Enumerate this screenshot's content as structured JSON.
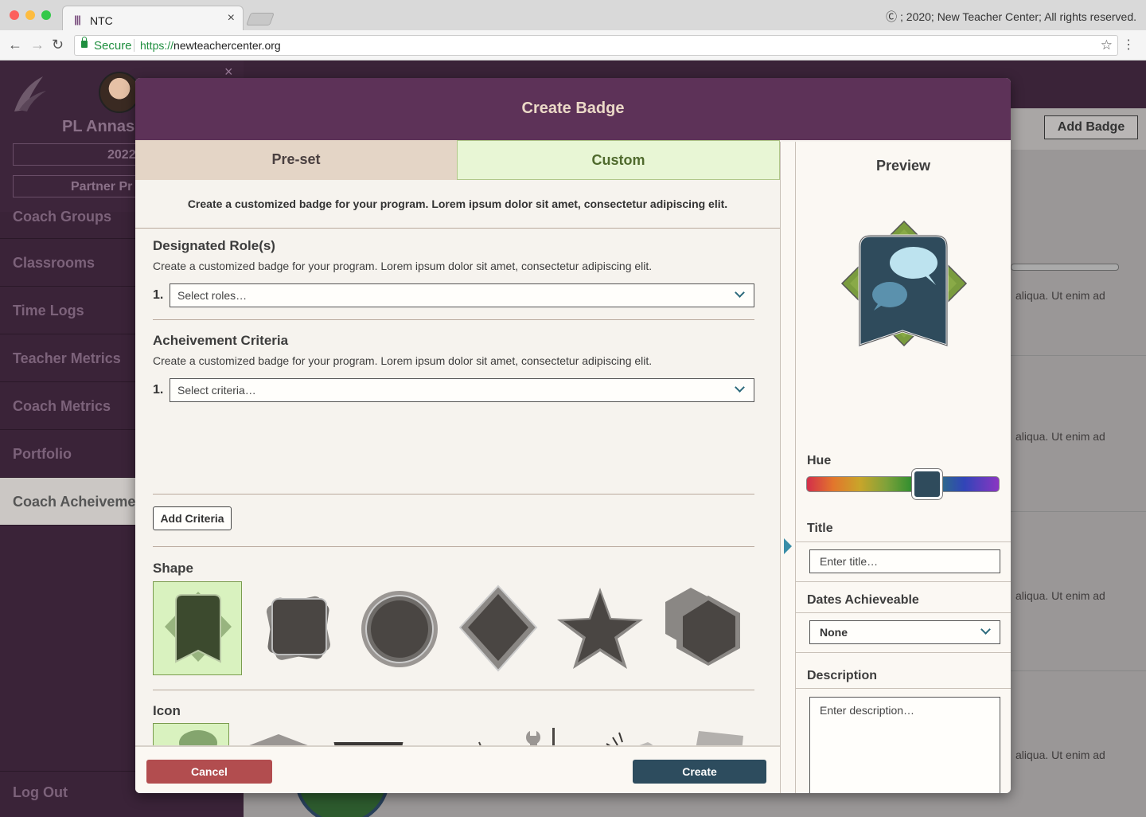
{
  "browser": {
    "tab_title": "NTC",
    "copyright": "Ⓒ ; 2020; New Teacher Center; All rights reserved.",
    "secure_label": "Secure",
    "url_scheme": "https://",
    "url_host": "newteachercenter.org"
  },
  "sidebar": {
    "user_name": "PL Annas",
    "year": "2022",
    "partner": "Partner Pr",
    "items": [
      {
        "label": "Coach Groups"
      },
      {
        "label": "Classrooms"
      },
      {
        "label": "Time Logs"
      },
      {
        "label": "Teacher Metrics"
      },
      {
        "label": "Coach Metrics"
      },
      {
        "label": "Portfolio"
      },
      {
        "label": "Coach Acheivements",
        "active": true
      }
    ],
    "logout": "Log Out"
  },
  "background": {
    "add_badge_label": "Add Badge",
    "row_text": "aliqua. Ut enim ad"
  },
  "modal": {
    "title": "Create Badge",
    "tabs": {
      "preset": "Pre-set",
      "custom": "Custom"
    },
    "intro": "Create a customized badge for your program. Lorem ipsum dolor sit amet, consectetur adipiscing elit.",
    "roles": {
      "title": "Designated Role(s)",
      "desc": "Create a customized badge for your program. Lorem ipsum dolor sit amet, consectetur adipiscing elit.",
      "number": "1.",
      "placeholder": "Select roles…"
    },
    "criteria": {
      "title": "Acheivement Criteria",
      "desc": "Create a customized badge for your program. Lorem ipsum dolor sit amet, consectetur adipiscing elit.",
      "number": "1.",
      "placeholder": "Select criteria…",
      "add_label": "Add Criteria"
    },
    "shape": {
      "title": "Shape",
      "options": [
        "ribbon-badge",
        "square-badge",
        "circle-badge",
        "diamond-badge",
        "star-badge",
        "hexagon-badge"
      ],
      "selected_index": 0
    },
    "icon": {
      "title": "Icon",
      "options": [
        "speech-bubbles",
        "graduation-cap",
        "safety-goggles",
        "eyeglasses",
        "tools",
        "whistle",
        "document"
      ],
      "selected_index": 0
    },
    "footer": {
      "cancel": "Cancel",
      "create": "Create"
    },
    "preview": {
      "title": "Preview",
      "hue_label": "Hue",
      "hue_value": 0.62,
      "title_label": "Title",
      "title_placeholder": "Enter title…",
      "dates_label": "Dates Achieveable",
      "dates_value": "None",
      "description_label": "Description",
      "description_placeholder": "Enter description…"
    },
    "colors": {
      "header": "#5d3258",
      "selected_bg": "#d9f2bf",
      "badge_dark": "#2f4b5c",
      "badge_green": "#7a9c3e",
      "cancel": "#b24d4f",
      "create": "#2d4c5e"
    }
  }
}
